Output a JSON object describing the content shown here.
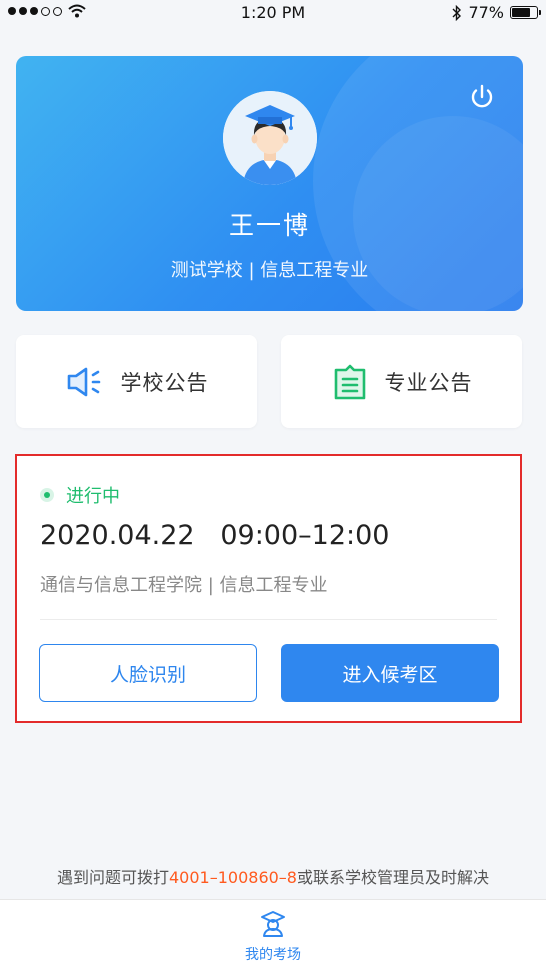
{
  "status_bar": {
    "time": "1:20 PM",
    "battery": "77%",
    "battery_level": 0.77,
    "signal_bars_filled": 3,
    "signal_bars_total": 5
  },
  "profile": {
    "name": "王一博",
    "school_major": "测试学校 | 信息工程专业",
    "power_icon": "power-icon",
    "avatar_icon": "graduate-avatar"
  },
  "notices": [
    {
      "label": "学校公告",
      "icon": "speaker-icon"
    },
    {
      "label": "专业公告",
      "icon": "document-icon"
    }
  ],
  "exam": {
    "status": "进行中",
    "datetime": "2020.04.22   09:00–12:00",
    "department": "通信与信息工程学院 | 信息工程专业",
    "face_button": "人脸识别",
    "enter_button": "进入候考区"
  },
  "help": {
    "prefix": "遇到问题可拨打",
    "phone": "4001–100860–8",
    "suffix": "或联系学校管理员及时解决"
  },
  "tabbar": {
    "items": [
      {
        "label": "我的考场",
        "icon": "exam-room-icon"
      }
    ]
  },
  "colors": {
    "primary": "#2f87ef",
    "status_green": "#1fbd6e",
    "highlight_red": "#e32b2b",
    "phone_orange": "#ff5a1f"
  }
}
